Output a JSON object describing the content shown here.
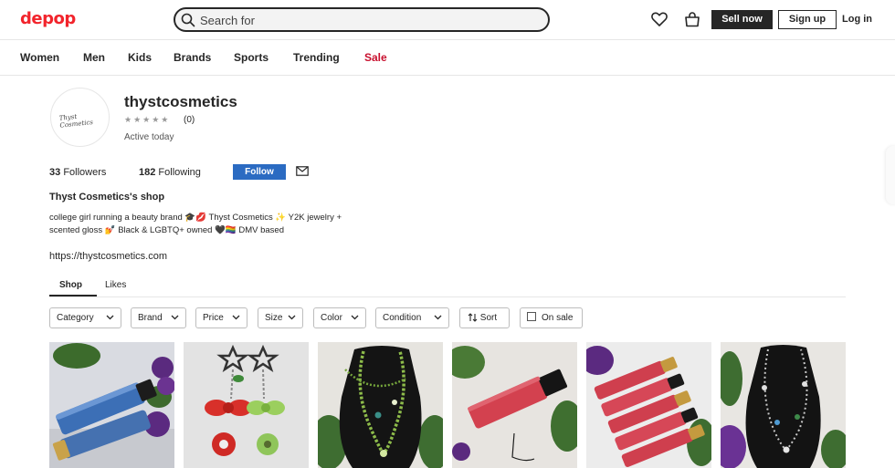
{
  "header": {
    "logo": "depop",
    "search_placeholder": "Search for",
    "icons": {
      "search": "search-icon",
      "likes": "heart-icon",
      "bag": "shopping-bag-icon"
    },
    "sell_label": "Sell now",
    "signup_label": "Sign up",
    "login_label": "Log in"
  },
  "nav": {
    "items": [
      "Women",
      "Men",
      "Kids",
      "Brands",
      "Sports",
      "Trending",
      "Sale"
    ],
    "sale_color": "#c8102e"
  },
  "profile": {
    "avatar_text": "Thyst Cosmetics",
    "username": "thystcosmetics",
    "stars": "★★★★★",
    "review_count": "(0)",
    "status": "Active today",
    "followers_count": "33",
    "followers_label": "Followers",
    "following_count": "182",
    "following_label": "Following",
    "follow_label": "Follow",
    "shop_name": "Thyst Cosmetics's shop",
    "bio": "college girl running a beauty brand 🎓💋 Thyst Cosmetics ✨ Y2K jewelry + scented gloss 💅 Black & LGBTQ+ owned 🖤🏳️‍🌈 DMV based",
    "website": "https://thystcosmetics.com"
  },
  "tabs": [
    "Shop",
    "Likes"
  ],
  "filters": {
    "category": "Category",
    "brand": "Brand",
    "price": "Price",
    "size": "Size",
    "color": "Color",
    "condition": "Condition",
    "sort": "Sort",
    "on_sale": "On sale"
  },
  "products": [
    {
      "subject": "blue lip gloss tubes with purple flowers"
    },
    {
      "subject": "star keychain earrings with red bow and apple charms"
    },
    {
      "subject": "green beaded necklace on black bust"
    },
    {
      "subject": "red lip gloss tube with Scented gloss label"
    },
    {
      "subject": "stack of red lip gloss tubes with gold caps"
    },
    {
      "subject": "silver charm necklace on black bust"
    }
  ],
  "colors": {
    "brand_red": "#f2242c",
    "follow_blue": "#2b6bc2",
    "text": "#262626"
  }
}
